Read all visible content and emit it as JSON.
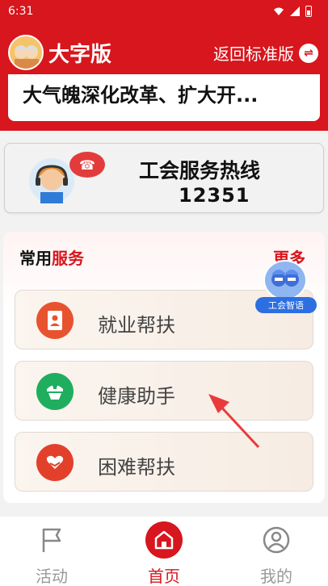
{
  "status_bar": {
    "time": "6:31"
  },
  "header": {
    "title": "大字版",
    "back_label": "返回标准版"
  },
  "news": {
    "text": "大气魄深化改革、扩大开..."
  },
  "hotline": {
    "title": "工会服务热线",
    "number": "12351"
  },
  "services": {
    "title_part1": "常用",
    "title_part2": "服务",
    "more": "更多",
    "items": [
      {
        "label": "就业帮扶",
        "icon": "resume-icon",
        "color": "#e8532f"
      },
      {
        "label": "健康助手",
        "icon": "medical-kit-icon",
        "color": "#1fae5e"
      },
      {
        "label": "困难帮扶",
        "icon": "heart-hand-icon",
        "color": "#e3402c"
      }
    ]
  },
  "ai_widget": {
    "label": "工会智语"
  },
  "tabbar": {
    "tabs": [
      {
        "label": "活动",
        "icon": "flag-icon"
      },
      {
        "label": "首页",
        "icon": "home-icon"
      },
      {
        "label": "我的",
        "icon": "user-icon"
      }
    ]
  },
  "colors": {
    "brand": "#d7161d"
  }
}
